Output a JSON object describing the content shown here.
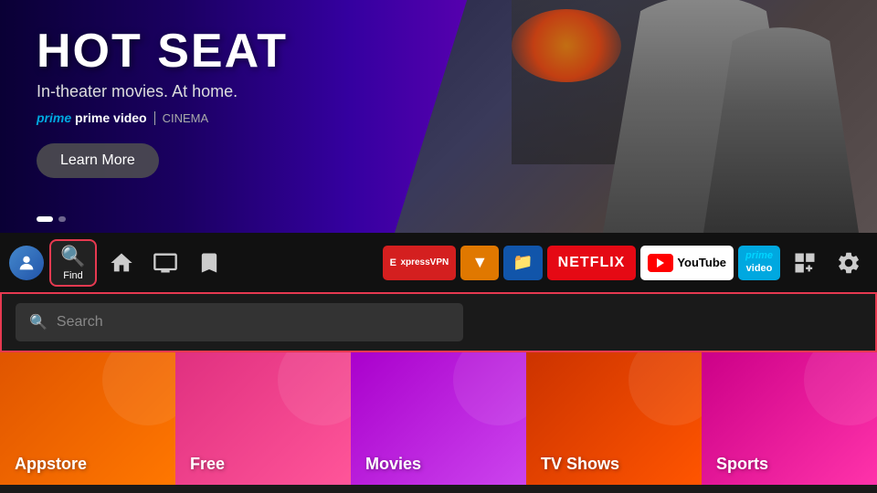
{
  "hero": {
    "title": "HOT SEAT",
    "subtitle": "In-theater movies. At home.",
    "brand": "prime video",
    "cinema": "CINEMA",
    "learn_more": "Learn More"
  },
  "navbar": {
    "find_label": "Find",
    "search_placeholder": "Search"
  },
  "apps": [
    {
      "id": "expressvpn",
      "label": "ExpressVPN"
    },
    {
      "id": "downloader",
      "label": "Downloader"
    },
    {
      "id": "file-manager",
      "label": "File Manager"
    },
    {
      "id": "netflix",
      "label": "NETFLIX"
    },
    {
      "id": "youtube",
      "label": "YouTube"
    },
    {
      "id": "prime-video",
      "label": "prime video"
    }
  ],
  "categories": [
    {
      "id": "appstore",
      "label": "Appstore"
    },
    {
      "id": "free",
      "label": "Free"
    },
    {
      "id": "movies",
      "label": "Movies"
    },
    {
      "id": "tv-shows",
      "label": "TV Shows"
    },
    {
      "id": "sports",
      "label": "Sports"
    }
  ]
}
